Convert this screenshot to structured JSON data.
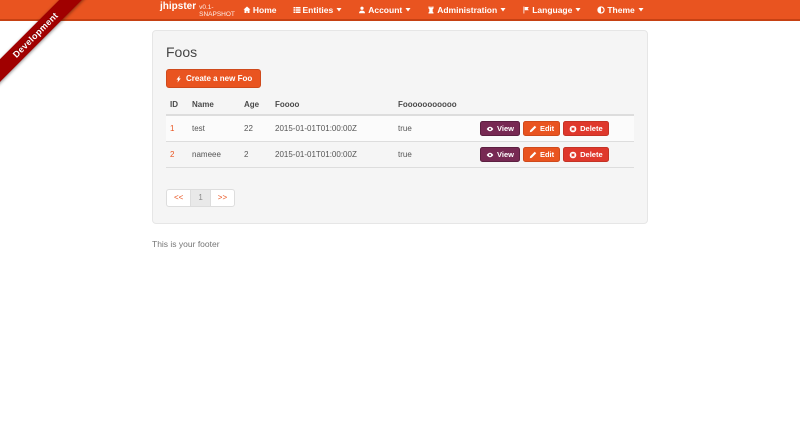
{
  "ribbon": {
    "label": "Development"
  },
  "navbar": {
    "brand": "jhipster",
    "version": "v0.1-SNAPSHOT",
    "items": [
      {
        "label": "Home"
      },
      {
        "label": "Entities"
      },
      {
        "label": "Account"
      },
      {
        "label": "Administration"
      },
      {
        "label": "Language"
      },
      {
        "label": "Theme"
      }
    ]
  },
  "main": {
    "title": "Foos",
    "create_button": "Create a new Foo",
    "table": {
      "headers": [
        "ID",
        "Name",
        "Age",
        "Foooo",
        "Fooooooooooo"
      ],
      "rows": [
        {
          "id": "1",
          "name": "test",
          "age": "22",
          "foooo": "2015-01-01T01:00:00Z",
          "fooooooooooo": "true"
        },
        {
          "id": "2",
          "name": "nameee",
          "age": "2",
          "foooo": "2015-01-01T01:00:00Z",
          "fooooooooooo": "true"
        }
      ],
      "actions": {
        "view": "View",
        "edit": "Edit",
        "delete": "Delete"
      }
    },
    "pagination": {
      "first": "<<",
      "page": "1",
      "last": ">>"
    }
  },
  "footer": {
    "text": "This is your footer"
  },
  "colors": {
    "navbar": "#e95420",
    "navbar_border": "#c64113",
    "ribbon": "#a00000",
    "primary": "#e95420",
    "info_view": "#772953",
    "danger_delete": "#df382c",
    "well_bg": "#f5f5f5"
  }
}
